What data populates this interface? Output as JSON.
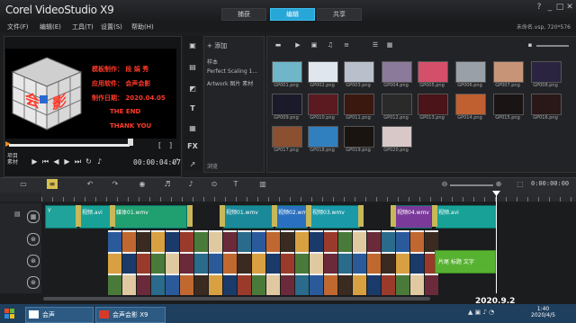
{
  "app": {
    "title": "Corel VideoStudio X9"
  },
  "mode_tabs": [
    {
      "label": "捕获",
      "active": false
    },
    {
      "label": "编辑",
      "active": true
    },
    {
      "label": "共享",
      "active": false
    }
  ],
  "window_buttons": [
    "?",
    "_",
    "□",
    "✕"
  ],
  "menu": [
    "文件(F)",
    "编辑(E)",
    "工具(T)",
    "设置(S)",
    "帮助(H)"
  ],
  "project_info": "未命名.vsp, 720*576",
  "preview": {
    "cube_chars": [
      "会",
      "影"
    ],
    "text_lines": [
      "模板制作：  段 娟 秀",
      "应用软件：  会声会影",
      "制作日期：  2020.04.05",
      "THE   END",
      "THANK  YOU"
    ],
    "mode_labels": [
      "项目",
      "素材"
    ],
    "timecode": "00:00:04:07"
  },
  "library": {
    "strip_icons": [
      "media-icon",
      "instant-project-icon",
      "transition-icon",
      "title-icon",
      "graphic-icon",
      "filter-icon",
      "path-icon"
    ],
    "add_label": "+ 添加",
    "folders": [
      "样本",
      "Perfect Scaling 1...",
      "Artwork 图片 素材"
    ],
    "footer": "浏览",
    "thumbs": [
      {
        "label": "GP001.png",
        "color": "#6fb7c8"
      },
      {
        "label": "GP002.png",
        "color": "#dfe6ee"
      },
      {
        "label": "GP003.png",
        "color": "#b9c0cc"
      },
      {
        "label": "GP004.png",
        "color": "#8c7a9a"
      },
      {
        "label": "GP005.png",
        "color": "#d4506a"
      },
      {
        "label": "GP006.png",
        "color": "#9aa0a8"
      },
      {
        "label": "GP007.png",
        "color": "#c89478"
      },
      {
        "label": "GP008.png",
        "color": "#2a2440"
      },
      {
        "label": "GP009.png",
        "color": "#1a1a2a"
      },
      {
        "label": "GP010.png",
        "color": "#5a1a20"
      },
      {
        "label": "GP011.png",
        "color": "#3a1810"
      },
      {
        "label": "GP012.png",
        "color": "#2a2a2a"
      },
      {
        "label": "GP013.png",
        "color": "#4a1418"
      },
      {
        "label": "GP014.png",
        "color": "#c06030"
      },
      {
        "label": "GP015.png",
        "color": "#1a1414"
      },
      {
        "label": "GP016.png",
        "color": "#2a1818"
      },
      {
        "label": "GP017.png",
        "color": "#8a5030"
      },
      {
        "label": "GP018.png",
        "color": "#3080c0"
      },
      {
        "label": "GP019.png",
        "color": "#1a1410"
      },
      {
        "label": "GP020.png",
        "color": "#d8c8c8"
      }
    ]
  },
  "timeline": {
    "time": "0:00:00:00",
    "video_clips": [
      {
        "label": "Y"
      },
      {
        "label": "视频.avi"
      },
      {
        "label": "媒体01.wmv"
      },
      {
        "label": "视频01.wmv"
      },
      {
        "label": "视频02.wmv"
      },
      {
        "label": "视频03.wmv"
      },
      {
        "label": "视频04.wmv"
      },
      {
        "label": "视频.avi"
      }
    ],
    "title_clip": "片尾 标题 文字"
  },
  "taskbar": {
    "items": [
      "会声",
      "会声会影 X9"
    ],
    "clock_time": "1:40",
    "clock_date": "2020/4/5",
    "watermark": "2020.9.2"
  }
}
